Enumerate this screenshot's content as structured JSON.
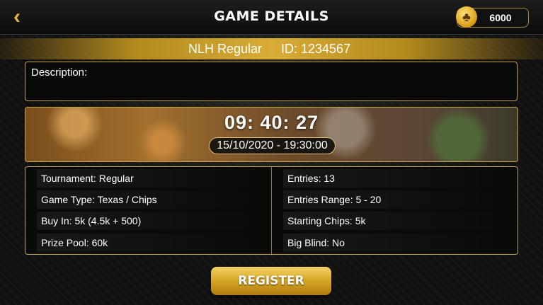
{
  "header": {
    "back_icon": "chevron-left-icon",
    "back_glyph": "‹",
    "title": "GAME DETAILS",
    "coin_icon": "club-coin-icon",
    "coin_glyph": "♣",
    "coins": "6000"
  },
  "game": {
    "name": "NLH Regular",
    "id_label": "ID: 1234567"
  },
  "description": {
    "label": "Description:"
  },
  "timer": {
    "countdown": "09: 40: 27",
    "datetime": "15/10/2020 - 19:30:00"
  },
  "details": {
    "left": [
      "Tournament: Regular",
      "Game Type: Texas / Chips",
      "Buy In: 5k (4.5k + 500)",
      "Prize Pool: 60k"
    ],
    "right": [
      "Entries: 13",
      "Entries Range: 5 - 20",
      "Starting Chips: 5k",
      "Big Blind: No"
    ]
  },
  "actions": {
    "register_label": "REGISTER"
  },
  "colors": {
    "accent_gold": "#d9a928",
    "border_gold": "#c7a24a"
  }
}
